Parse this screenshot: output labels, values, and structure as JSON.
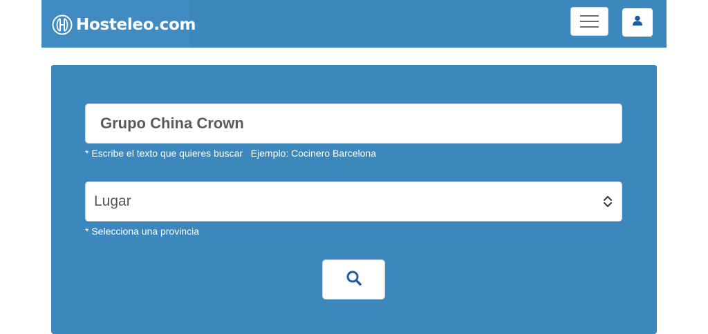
{
  "header": {
    "logo_text": "Hosteleo.com",
    "menu_icon": "hamburger-menu-icon",
    "user_icon": "user-icon",
    "background_color": "#3c87bb"
  },
  "search_form": {
    "query_value": "Grupo China Crown",
    "query_helper": "* Escribe el texto que quieres buscar   Ejemplo: Cocinero Barcelona",
    "location_selected": "Lugar",
    "location_helper": "* Selecciona una provincia",
    "select_icon": "chevron-up-down-icon",
    "search_icon": "search-icon",
    "accent_color": "#1f5aa3"
  }
}
